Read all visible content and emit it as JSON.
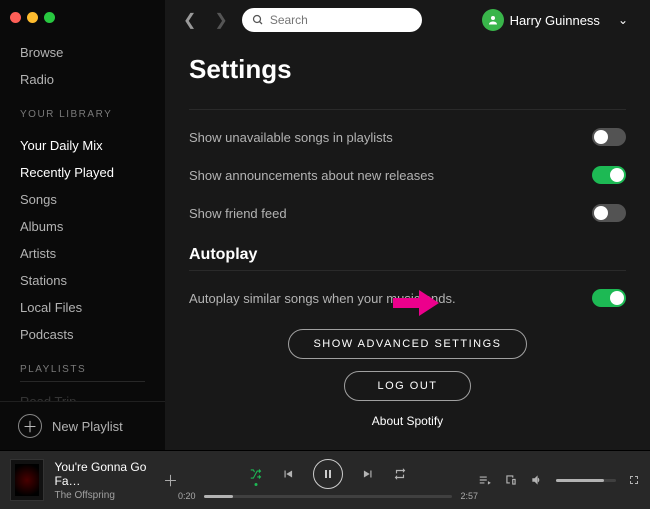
{
  "sidebar": {
    "main_nav": [
      "Browse",
      "Radio"
    ],
    "library_header": "YOUR LIBRARY",
    "library_items": [
      "Your Daily Mix",
      "Recently Played",
      "Songs",
      "Albums",
      "Artists",
      "Stations",
      "Local Files",
      "Podcasts"
    ],
    "playlists_header": "PLAYLISTS",
    "playlists": [
      "Road Trip"
    ],
    "new_playlist_label": "New Playlist"
  },
  "topbar": {
    "search_placeholder": "Search",
    "user_name": "Harry Guinness"
  },
  "settings": {
    "title": "Settings",
    "rows": [
      {
        "label": "Show unavailable songs in playlists",
        "on": false
      },
      {
        "label": "Show announcements about new releases",
        "on": true
      },
      {
        "label": "Show friend feed",
        "on": false
      }
    ],
    "autoplay_header": "Autoplay",
    "autoplay_row": {
      "label": "Autoplay similar songs when your music ends.",
      "on": true
    },
    "advanced_button": "SHOW ADVANCED SETTINGS",
    "logout_button": "LOG OUT",
    "about_label": "About Spotify"
  },
  "player": {
    "track_title": "You're Gonna Go Fa…",
    "artist": "The Offspring",
    "elapsed": "0:20",
    "duration": "2:57"
  },
  "colors": {
    "accent": "#1db954",
    "callout": "#ec008c"
  }
}
